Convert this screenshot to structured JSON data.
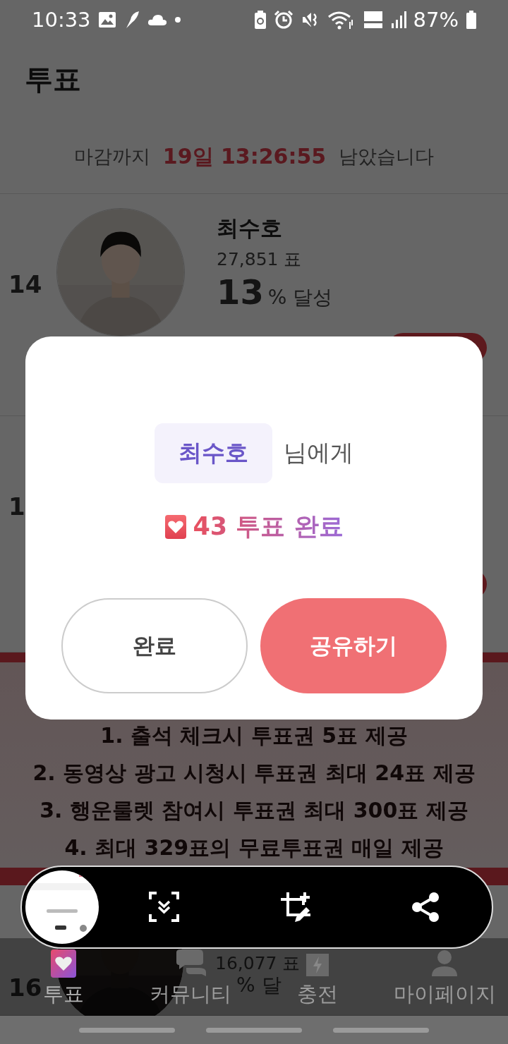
{
  "status_bar": {
    "time": "10:33",
    "battery": "87%"
  },
  "header": {
    "title": "투표"
  },
  "countdown": {
    "prefix": "마감까지",
    "remaining": "19일 13:26:55",
    "suffix": "남았습니다"
  },
  "candidates": [
    {
      "rank": "14",
      "name": "최수호",
      "votes": "27,851 표",
      "percent": "13",
      "percent_suffix": "% 달성"
    },
    {
      "rank": "1"
    },
    {
      "rank": "16",
      "votes": "16,077 표",
      "percent_suffix": "% 달"
    }
  ],
  "banner": {
    "lines": [
      "1. 출석 체크시 투표권 5표 제공",
      "2. 동영상 광고 시청시 투표권 최대 24표 제공",
      "3. 행운룰렛 참여시 투표권 최대 300표 제공",
      "4. 최대 329표의 무료투표권 매일 제공"
    ]
  },
  "dialog": {
    "recipient": "최수호",
    "recipient_suffix": "님에게",
    "result": "43 투표 완료",
    "buttons": [
      {
        "label": "완료",
        "kind": "secondary"
      },
      {
        "label": "공유하기",
        "kind": "primary"
      }
    ]
  },
  "bottom_nav": [
    {
      "label": "투표",
      "selected": true
    },
    {
      "label": "커뮤니티",
      "selected": false
    },
    {
      "label": "충전",
      "selected": false
    },
    {
      "label": "마이페이지",
      "selected": false
    }
  ]
}
